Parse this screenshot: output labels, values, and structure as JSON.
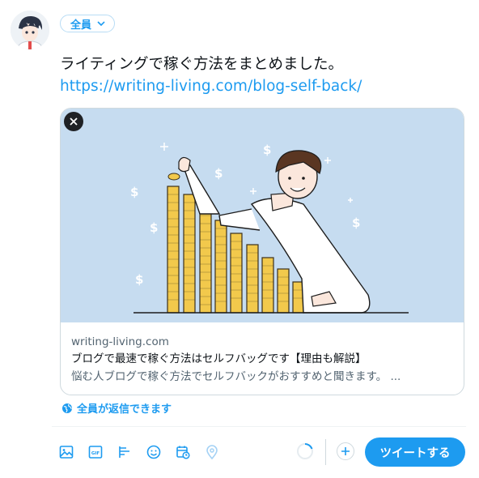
{
  "composer": {
    "audience_label": "全員",
    "text": "ライティングで稼ぐ方法をまとめました。",
    "link": "https://writing-living.com/blog-self-back/",
    "reply_setting": "全員が返信できます"
  },
  "card": {
    "domain": "writing-living.com",
    "title": "ブログで最速で稼ぐ方法はセルフバッグです【理由も解説】",
    "description": "悩む人ブログで稼ぐ方法でセルフバックがおすすめと聞きます。 ..."
  },
  "toolbar": {
    "icons": [
      "image-icon",
      "gif-icon",
      "poll-icon",
      "emoji-icon",
      "schedule-icon",
      "location-icon"
    ],
    "tweet_button": "ツイートする"
  },
  "colors": {
    "accent": "#1d9bf0",
    "card_image_bg": "#c6dcf0",
    "coin": "#f2c94c"
  }
}
